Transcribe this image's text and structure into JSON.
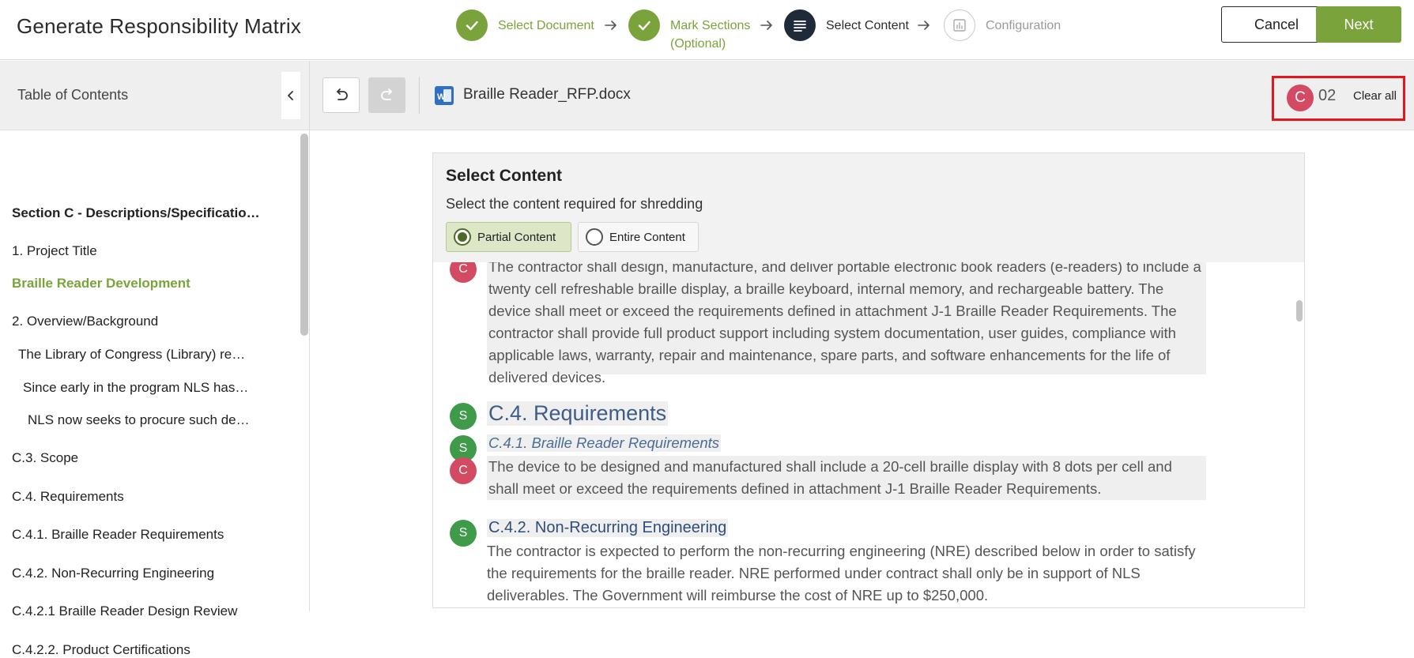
{
  "header": {
    "title": "Generate Responsibility Matrix",
    "steps": [
      {
        "label": "Select Document",
        "state": "done"
      },
      {
        "label": "Mark Sections",
        "sublabel": "(Optional)",
        "state": "done"
      },
      {
        "label": "Select Content",
        "state": "current"
      },
      {
        "label": "Configuration",
        "state": "pending"
      }
    ],
    "cancel_label": "Cancel",
    "next_label": "Next"
  },
  "sidebar": {
    "title": "Table of Contents",
    "items": [
      "Section C - Descriptions/Specificatio…",
      "1. Project Title",
      "Braille Reader Development",
      "2. Overview/Background",
      "The Library of Congress (Library) re…",
      "Since early in the program NLS has…",
      "NLS now seeks to procure such de…",
      "C.3. Scope",
      "C.4. Requirements",
      "C.4.1. Braille Reader Requirements",
      "C.4.2. Non-Recurring Engineering",
      "C.4.2.1 Braille Reader Design Review",
      "C.4.2.2. Product Certifications"
    ],
    "active_item": "Braille Reader Development"
  },
  "toolbar": {
    "document_name": "Braille Reader_RFP.docx",
    "tag_letter": "C",
    "tag_count": "02",
    "clear_all_label": "Clear all"
  },
  "panel": {
    "title": "Select Content",
    "subtitle": "Select the content required for shredding",
    "options": [
      {
        "label": "Partial Content",
        "selected": true
      },
      {
        "label": "Entire Content",
        "selected": false
      }
    ]
  },
  "content": {
    "markers": [
      "C",
      "S",
      "S",
      "C",
      "S"
    ],
    "para1": "The contractor shall design, manufacture, and deliver portable electronic book readers (e-readers) to include a twenty cell refreshable braille display, a braille keyboard, internal memory, and rechargeable battery. The device shall meet or exceed the requirements defined in attachment J-1 Braille Reader Requirements. The contractor shall provide full product support including system documentation, user guides, compliance with applicable laws, warranty, repair and maintenance, spare parts, and software enhancements for the life of delivered devices.",
    "heading_requirements": "C.4. Requirements",
    "heading_braille": "C.4.1. Braille Reader Requirements",
    "para2": "The device to be designed and manufactured shall include a 20-cell braille display with 8 dots per cell and shall meet or exceed the requirements defined in attachment J-1 Braille Reader Requirements.",
    "heading_nre": "C.4.2. Non-Recurring Engineering",
    "para3": "The contractor is expected to perform the non-recurring engineering (NRE) described below in order to satisfy the requirements for the braille reader. NRE performed under contract shall only be in support of NLS deliverables. The Government will reimburse the cost of NRE up to $250,000."
  },
  "colors": {
    "accent_green": "#7aa43b",
    "current_step": "#1f2b38",
    "marker_c": "#d44a62",
    "marker_s": "#3f9a4a",
    "highlight_border": "#e8141b"
  }
}
